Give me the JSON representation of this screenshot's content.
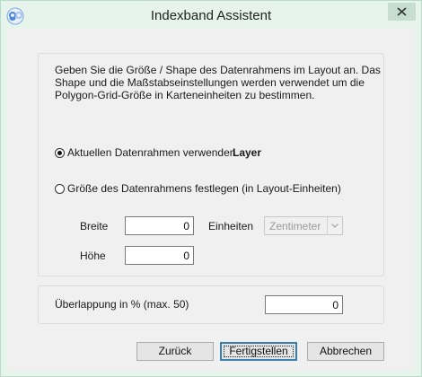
{
  "window": {
    "title": "Indexband Assistent",
    "app_icon": "go-logo-icon",
    "close_icon": "close-icon"
  },
  "description": {
    "lines": [
      "Geben Sie die Größe / Shape des Datenrahmens im Layout an. Das",
      "Shape und die Maßstabseinstellungen werden verwendet um die",
      "Polygon-Grid-Größe in Karteneinheiten zu bestimmen."
    ]
  },
  "options": {
    "current_frame": {
      "label": "Aktuellen Datenrahmen verwenden",
      "value": "Layer",
      "checked": true
    },
    "custom_size": {
      "label": "Größe des Datenrahmens festlegen (in Layout-Einheiten)",
      "checked": false
    }
  },
  "size": {
    "width_label": "Breite",
    "width_value": "0",
    "height_label": "Höhe",
    "height_value": "0",
    "units_label": "Einheiten",
    "units_value": "Zentimeter"
  },
  "overlap": {
    "label": "Überlappung in % (max. 50)",
    "value": "0"
  },
  "buttons": {
    "back": "Zurück",
    "finish": "Fertigstellen",
    "cancel": "Abbrechen"
  }
}
